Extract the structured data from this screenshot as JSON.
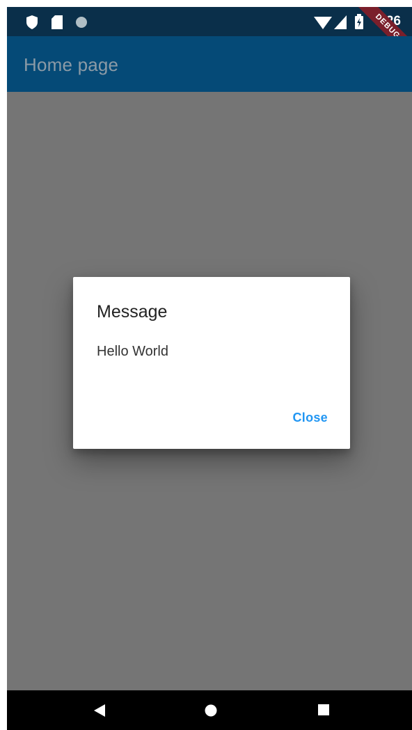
{
  "status_bar": {
    "time": "9:26",
    "debug_label": "DEBUG",
    "icons": [
      "shield-icon",
      "sd-card-icon",
      "circle-icon",
      "wifi-icon",
      "signal-icon",
      "battery-icon"
    ]
  },
  "app_bar": {
    "title": "Home page"
  },
  "dialog": {
    "title": "Message",
    "body": "Hello World",
    "action_label": "Close"
  },
  "nav_bar": {
    "icons": [
      "back-icon",
      "home-icon",
      "recents-icon"
    ]
  },
  "colors": {
    "app_bar": "#054a77",
    "status_bar": "#0a2f4a",
    "scrim": "#757575",
    "accent": "#2196f3",
    "debug_ribbon": "#7a1f2b"
  }
}
